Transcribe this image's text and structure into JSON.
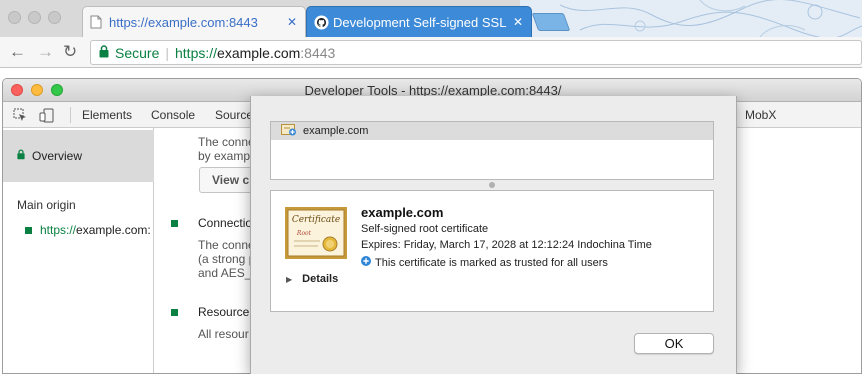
{
  "browser": {
    "tabs": [
      {
        "title": "https://example.com:8443",
        "close": "✕",
        "active": true
      },
      {
        "title": "Development Self-signed SSL",
        "close": "✕",
        "active": false
      }
    ],
    "nav": {
      "back": "←",
      "forward": "→",
      "reload": "↻"
    },
    "omnibox": {
      "secure_label": "Secure",
      "separator": "|",
      "url_scheme": "https://",
      "url_host": "example.com",
      "url_port": ":8443"
    }
  },
  "devtools": {
    "title": "Developer Tools - https://example.com:8443/",
    "tabs": [
      "Elements",
      "Console",
      "Source",
      "MobX"
    ],
    "sidebar": {
      "overview": "Overview",
      "main_origin_label": "Main origin",
      "origin_scheme": "https://",
      "origin_host": "example.com:"
    },
    "main": {
      "line1": "The conne",
      "line2": "by examp",
      "view_button": "View c",
      "connection_heading": "Connectio",
      "conn_line1": "The conne",
      "conn_line2": "(a strong p",
      "conn_line3": "and AES_",
      "resources_heading": "Resource",
      "res_line1": "All resour"
    }
  },
  "certificate_sheet": {
    "chain_item": "example.com",
    "name": "example.com",
    "type": "Self-signed root certificate",
    "expires": "Expires: Friday, March 17, 2028 at 12:12:24 Indochina Time",
    "trusted": "This certificate is marked as trusted for all users",
    "details_label": "Details",
    "ok_label": "OK",
    "cert_image_word": "Certificate",
    "cert_image_sub": "Root"
  },
  "colors": {
    "secure_green": "#0b8043",
    "tab_blue": "#3d8bd8",
    "link_blue": "#3a6fc6"
  }
}
